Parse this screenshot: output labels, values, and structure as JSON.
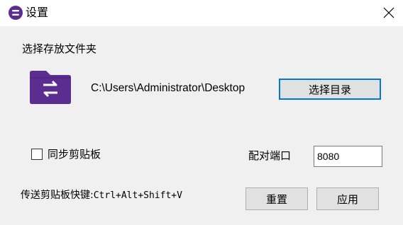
{
  "window": {
    "title": "设置",
    "accent_color": "#0078d7",
    "app_icon_color": "#5b2d91"
  },
  "storage": {
    "section_label": "选择存放文件夹",
    "path": "C:\\Users\\Administrator\\Desktop",
    "select_dir_label": "选择目录",
    "folder_icon_color": "#5b2d91"
  },
  "clipboard_sync": {
    "label": "同步剪贴板",
    "checked": false
  },
  "port": {
    "label": "配对端口",
    "value": "8080"
  },
  "shortcut": {
    "label": "传送剪贴板快键:",
    "keys": "Ctrl+Alt+Shift+V"
  },
  "actions": {
    "reset_label": "重置",
    "apply_label": "应用"
  }
}
